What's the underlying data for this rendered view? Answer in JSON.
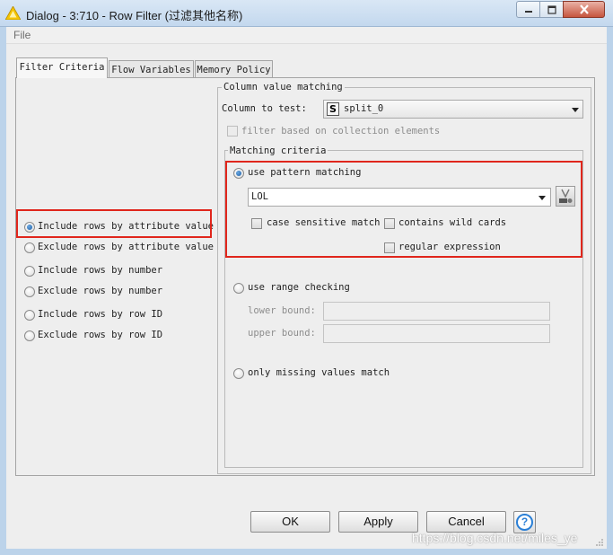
{
  "window": {
    "title": "Dialog - 3:710 - Row Filter (过滤其他名称)"
  },
  "menu": {
    "items": [
      "File"
    ]
  },
  "tabs": [
    {
      "label": "Filter Criteria",
      "active": true
    },
    {
      "label": "Flow Variables",
      "active": false
    },
    {
      "label": "Memory Policy",
      "active": false
    }
  ],
  "filter_modes": {
    "options": [
      {
        "label": "Include rows by attribute value",
        "selected": true
      },
      {
        "label": "Exclude rows by attribute value",
        "selected": false
      },
      {
        "label": "Include rows by number",
        "selected": false
      },
      {
        "label": "Exclude rows by number",
        "selected": false
      },
      {
        "label": "Include rows by row ID",
        "selected": false
      },
      {
        "label": "Exclude rows by row ID",
        "selected": false
      }
    ]
  },
  "column_matching": {
    "group_title": "Column value matching",
    "column_label": "Column to test:",
    "column_type_badge": "S",
    "column_value": "split_0",
    "collection_label": "filter based on collection elements"
  },
  "matching_criteria": {
    "group_title": "Matching criteria",
    "pattern": {
      "label": "use pattern matching",
      "selected": true,
      "value": "LOL",
      "case_sensitive_label": "case sensitive match",
      "wildcards_label": "contains wild cards",
      "regex_label": "regular expression"
    },
    "range": {
      "label": "use range checking",
      "selected": false,
      "lower_label": "lower bound:",
      "upper_label": "upper bound:"
    },
    "missing": {
      "label": "only missing values match",
      "selected": false
    }
  },
  "buttons": {
    "ok": "OK",
    "apply": "Apply",
    "cancel": "Cancel",
    "help": "?"
  },
  "watermark": "https://blog.csdn.net/miles_ye",
  "colors": {
    "highlight": "#e0261c",
    "accent": "#2a7fd6"
  }
}
